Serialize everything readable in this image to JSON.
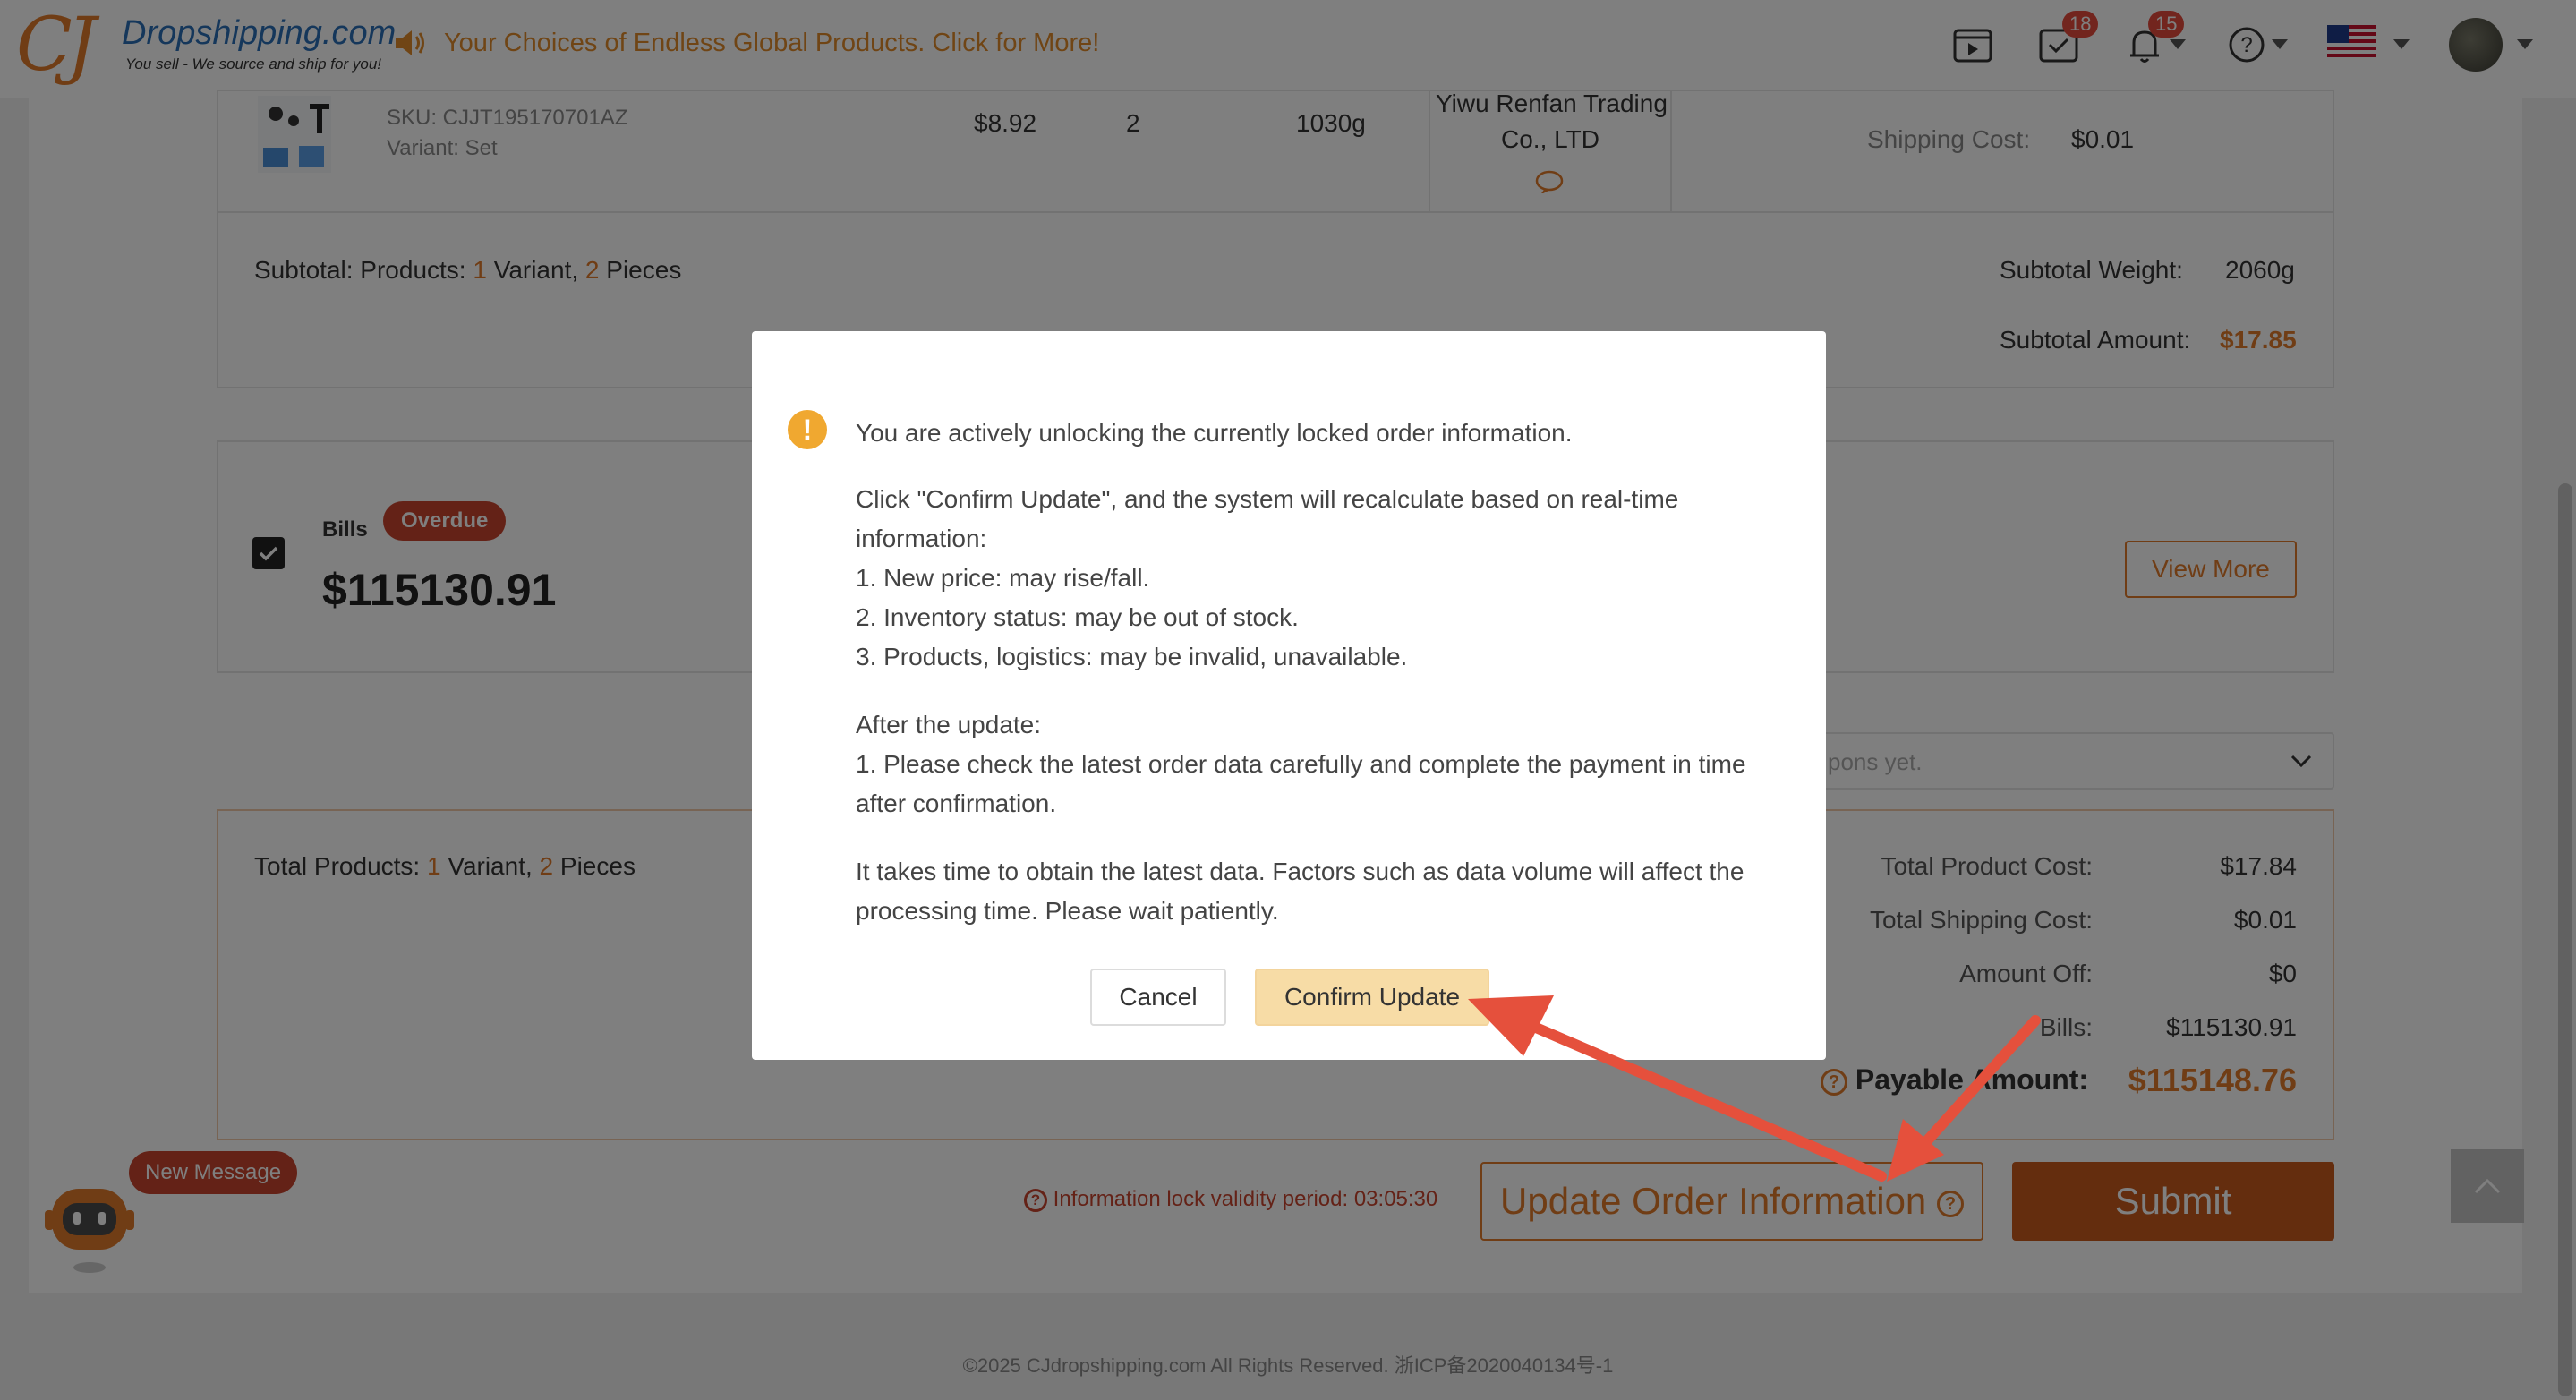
{
  "header": {
    "logo": {
      "brand": "Dropshipping.com",
      "tagline": "You sell - We source and ship for you!"
    },
    "marquee": "Your Choices of Endless Global Products. Click for More!",
    "badges": {
      "tasks": "18",
      "notifications": "15"
    }
  },
  "product": {
    "sku": "SKU: CJJT195170701AZ",
    "variant": "Variant: Set",
    "price": "$8.92",
    "quantity": "2",
    "weight": "1030g",
    "supplier_line1": "Yiwu Renfan Trading",
    "supplier_line2": "Co., LTD",
    "shipping_cost_label": "Shipping Cost:",
    "shipping_cost_value": "$0.01"
  },
  "subtotal": {
    "label": "Subtotal: Products:",
    "variant_count": "1",
    "variant_word": "Variant,",
    "piece_count": "2",
    "piece_word": "Pieces",
    "weight_label": "Subtotal Weight:",
    "weight_value": "2060g",
    "amount_label": "Subtotal Amount:",
    "amount_value": "$17.85"
  },
  "bills": {
    "label": "Bills",
    "badge": "Overdue",
    "amount": "$115130.91",
    "view_more": "View More"
  },
  "coupon": {
    "placeholder": "pons yet."
  },
  "totals": {
    "label": "Total Products:",
    "variant_count": "1",
    "variant_word": "Variant,",
    "piece_count": "2",
    "piece_word": "Pieces",
    "product_cost_label": "Total Product Cost:",
    "product_cost_value": "$17.84",
    "shipping_cost_label": "Total Shipping Cost:",
    "shipping_cost_value": "$0.01",
    "amount_off_label": "Amount Off:",
    "amount_off_value": "$0",
    "bills_label": "Bills:",
    "bills_value": "$115130.91",
    "payable_label_left": "Payable",
    "payable_label_right": "Amount:",
    "payable_value": "$115148.76"
  },
  "actions": {
    "lock_info": "Information lock validity period: 03:05:30",
    "update_button": "Update Order Information",
    "submit_button": "Submit"
  },
  "chat": {
    "new_message": "New Message"
  },
  "footer": "©2025 CJdropshipping.com All Rights Reserved. 浙ICP备2020040134号-1",
  "modal": {
    "headline": "You are actively unlocking the currently locked order information.",
    "para1_line1": "Click \"Confirm Update\", and the system will recalculate based on real-time",
    "para1_line2": "information:",
    "item1": "1. New price: may rise/fall.",
    "item2": "2. Inventory status: may be out of stock.",
    "item3": "3. Products, logistics: may be invalid, unavailable.",
    "after_title": "After the update:",
    "after_line1": "1. Please check the latest order data carefully and complete the payment in time",
    "after_line2": "after confirmation.",
    "wait_line1": "It takes time to obtain the latest data. Factors such as data volume will affect the",
    "wait_line2": "processing time. Please wait patiently.",
    "cancel": "Cancel",
    "confirm": "Confirm Update"
  },
  "colors": {
    "accent": "#e07a2a",
    "submit": "#c85a1c",
    "overdue": "#c8452e",
    "confirm_bg": "#f7dca6"
  }
}
